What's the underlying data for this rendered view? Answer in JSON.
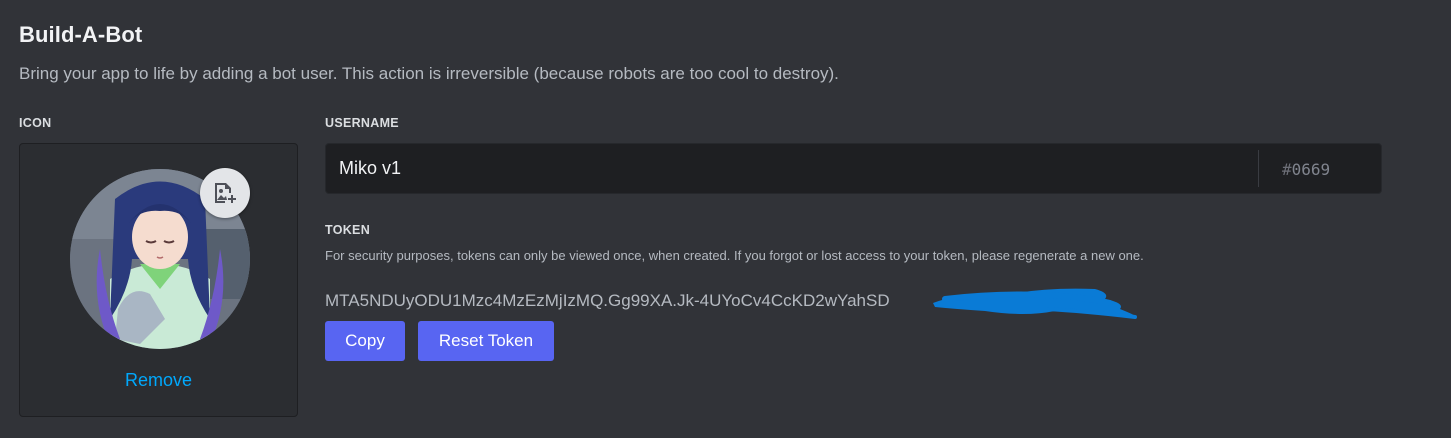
{
  "header": {
    "title": "Build-A-Bot",
    "subtitle": "Bring your app to life by adding a bot user. This action is irreversible (because robots are too cool to destroy)."
  },
  "icon_section": {
    "label": "ICON",
    "avatar_icon": "anime-girl-avatar",
    "upload_icon": "image-add-icon",
    "remove_label": "Remove"
  },
  "username_section": {
    "label": "USERNAME",
    "value": "Miko v1",
    "discriminator_hash": "#",
    "discriminator": "0669"
  },
  "token_section": {
    "label": "TOKEN",
    "description": "For security purposes, tokens can only be viewed once, when created. If you forgot or lost access to your token, please regenerate a new one.",
    "value": "MTA5NDUyODU1Mzc4MzEzMjIzMQ.Gg99XA.Jk-4UYoCv4CcKD2wYahSD",
    "copy_label": "Copy",
    "reset_label": "Reset Token"
  },
  "colors": {
    "background": "#313338",
    "button": "#5865f2",
    "link": "#00a8fc",
    "redaction": "#0a7bd6"
  }
}
